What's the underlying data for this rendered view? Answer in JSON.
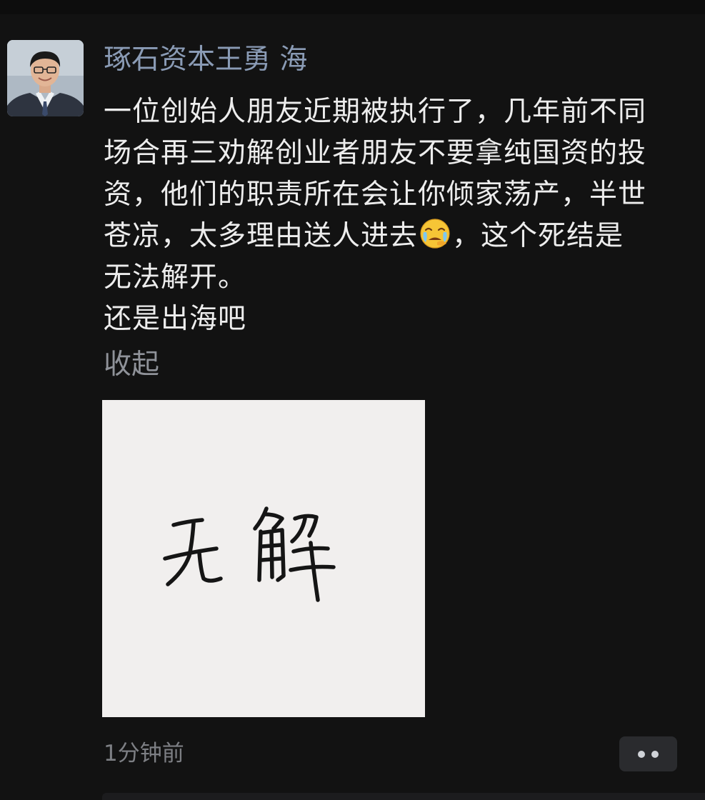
{
  "post": {
    "author": "琢石资本王勇 海",
    "avatar_icon": "person-portrait-icon",
    "body_lines": [
      "一位创始人朋友近期被执行了，几年前不同",
      "场合再三劝解创业者朋友不要拿纯国资的投",
      "资，他们的职责所在会让你倾家荡产，半世"
    ],
    "line4_before_emoji": "苍凉，太多理由送人进去",
    "emoji_icon": "crying-face-emoji-icon",
    "line4_after_emoji": "，这个死结是",
    "line5": "无法解开。",
    "line6": "还是出海吧",
    "collapse_label": "收起",
    "image_caption_handwritten": "无解",
    "timestamp": "1分钟前",
    "more_icon": "more-dots-icon"
  },
  "colors": {
    "background": "#121212",
    "author_name": "#8a9bb5",
    "body_text": "#ededed",
    "link_gray": "#8f9299",
    "timestamp": "#7d7f84",
    "action_button_bg": "#2a2b2e"
  }
}
